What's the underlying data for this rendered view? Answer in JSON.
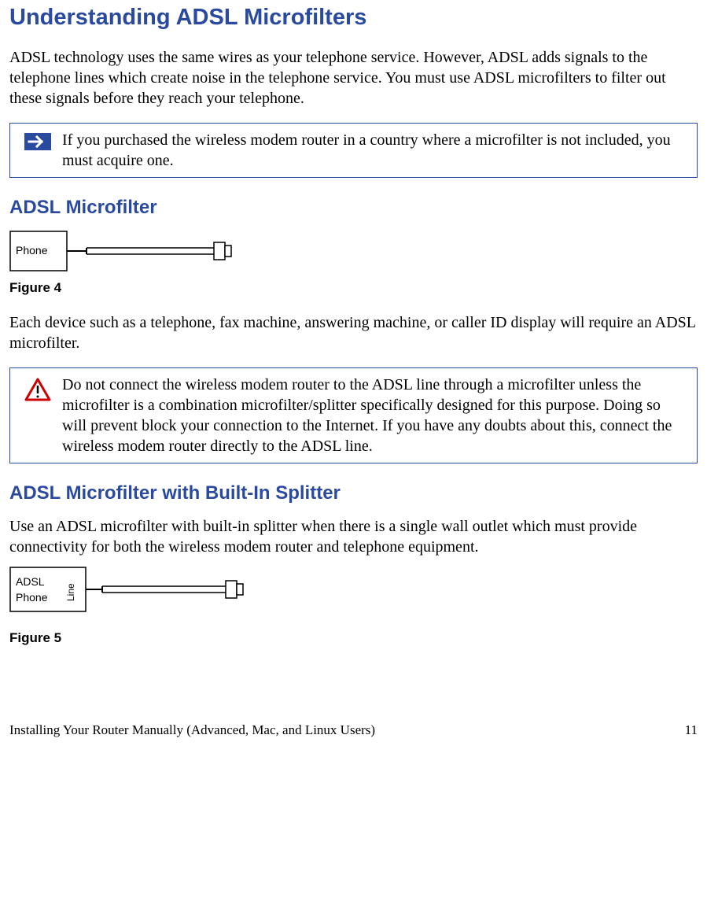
{
  "heading1": "Understanding ADSL Microfilters",
  "para1": "ADSL technology uses the same wires as your telephone service. However, ADSL adds signals to the telephone lines which create noise in the telephone service. You must use ADSL microfilters to filter out these signals before they reach your telephone.",
  "note1": "If you purchased the wireless modem router in a country where a microfilter is not included, you must acquire one.",
  "heading2": "ADSL Microfilter",
  "fig4_label": "Phone",
  "fig4_caption": "Figure 4",
  "para2": "Each device such as a telephone, fax machine, answering machine, or caller ID display will require an ADSL microfilter.",
  "warning1": "Do not connect the wireless modem router to the ADSL line through a microfilter unless the microfilter is a combination microfilter/splitter specifically designed for this purpose. Doing so will prevent block your connection to the Internet. If you have any doubts about this, connect the wireless modem router directly to the ADSL line.",
  "heading3": "ADSL Microfilter with Built-In Splitter",
  "para3": "Use an ADSL microfilter with built-in splitter when there is a single wall outlet which must provide connectivity for both the wireless modem router and telephone equipment.",
  "fig5_label1": "ADSL",
  "fig5_label2": "Phone",
  "fig5_sidelabel": "Line",
  "fig5_caption": "Figure 5",
  "footer_left": "Installing Your Router Manually (Advanced, Mac, and Linux Users)",
  "footer_right": "11"
}
